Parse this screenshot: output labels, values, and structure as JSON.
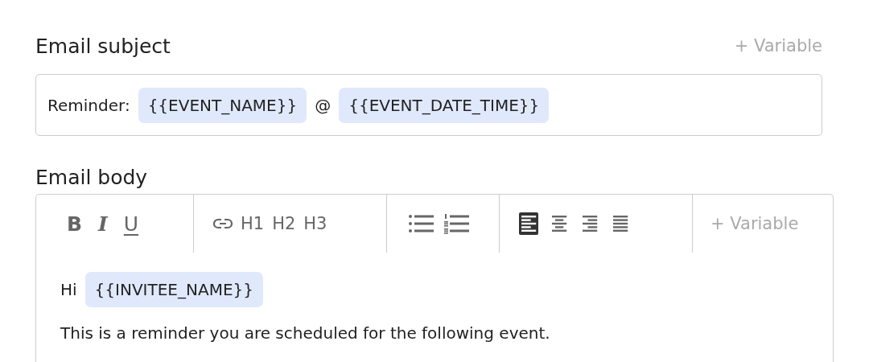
{
  "subject": {
    "label": "Email subject",
    "add_variable": "+ Variable",
    "parts": [
      {
        "kind": "text",
        "text": "Reminder:"
      },
      {
        "kind": "variable",
        "text": "{{EVENT_NAME}}"
      },
      {
        "kind": "text",
        "text": "@"
      },
      {
        "kind": "variable",
        "text": "{{EVENT_DATE_TIME}}"
      }
    ]
  },
  "body": {
    "label": "Email body",
    "format_buttons": [
      {
        "label": "B",
        "kind": "bold"
      },
      {
        "label": "I",
        "kind": "italic"
      },
      {
        "label": "U",
        "kind": "underline"
      }
    ],
    "heading_buttons": [
      "H1",
      "H2",
      "H3"
    ],
    "align_buttons": [
      {
        "kind": "left",
        "selected": true
      },
      {
        "kind": "center",
        "selected": false
      },
      {
        "kind": "right",
        "selected": false
      },
      {
        "kind": "justify",
        "selected": false
      }
    ],
    "add_variable": "+ Variable",
    "paragraphs": [
      [
        {
          "kind": "text",
          "text": "Hi"
        },
        {
          "kind": "variable",
          "text": "{{INVITEE_NAME}}"
        }
      ],
      [
        {
          "kind": "text",
          "text": "This is a reminder you are scheduled for the following event."
        }
      ]
    ]
  }
}
